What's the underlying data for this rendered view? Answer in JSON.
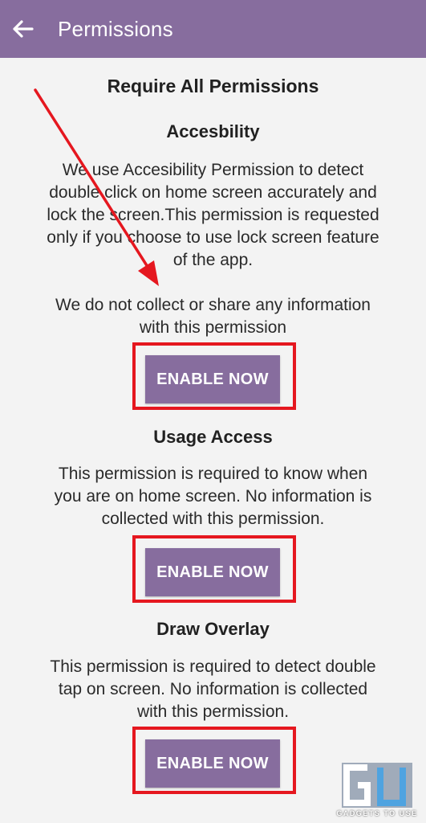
{
  "appbar": {
    "title": "Permissions",
    "back_icon": "arrow-left-icon",
    "color": "#876d9e"
  },
  "heading": "Require All Permissions",
  "sections": [
    {
      "title": "Accesbility",
      "description_lines": [
        "We use Accesibility Permission to detect",
        "double click on home screen accurately and",
        "lock the screen.This permission is requested",
        "only if you choose to use lock screen feature",
        "of the app."
      ],
      "note_lines": [
        "We do not collect or share any information",
        "with this permission"
      ],
      "button_label": "ENABLE NOW"
    },
    {
      "title": "Usage Access",
      "description_lines": [
        "This permission is required to know when",
        "you are on home screen. No information is",
        "collected with this permission."
      ],
      "button_label": "ENABLE NOW"
    },
    {
      "title": "Draw Overlay",
      "description_lines": [
        "This permission is required to detect double",
        "tap on screen. No information is collected",
        "with this permission."
      ],
      "button_label": "ENABLE NOW"
    }
  ],
  "annotation": {
    "highlight_color": "#e5171f",
    "arrow_color": "#e5171f"
  },
  "watermark": {
    "logo_text": "GU",
    "caption": "GADGETS TO USE"
  }
}
